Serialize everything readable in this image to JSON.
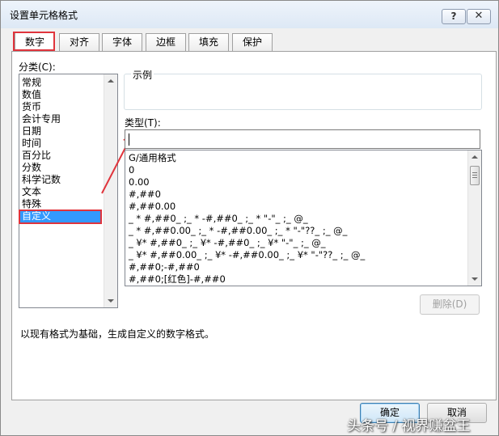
{
  "dialog": {
    "title": "设置单元格格式",
    "help_label": "?",
    "close_label": "✕"
  },
  "tabs": [
    "数字",
    "对齐",
    "字体",
    "边框",
    "填充",
    "保护"
  ],
  "category": {
    "label": "分类(C):",
    "items": [
      "常规",
      "数值",
      "货币",
      "会计专用",
      "日期",
      "时间",
      "百分比",
      "分数",
      "科学记数",
      "文本",
      "特殊",
      "自定义"
    ],
    "selected": "自定义"
  },
  "sample": {
    "label": "示例"
  },
  "type": {
    "label": "类型(T):",
    "value": "",
    "formats": [
      "G/通用格式",
      "0",
      "0.00",
      "#,##0",
      "#,##0.00",
      "_ * #,##0_ ;_ * -#,##0_ ;_ * \"-\"_ ;_ @_",
      "_ * #,##0.00_ ;_ * -#,##0.00_ ;_ * \"-\"??_ ;_ @_",
      "_ ¥* #,##0_ ;_ ¥* -#,##0_ ;_ ¥* \"-\"_ ;_ @_",
      "_ ¥* #,##0.00_ ;_ ¥* -#,##0.00_ ;_ ¥* \"-\"??_ ;_ @_",
      "#,##0;-#,##0",
      "#,##0;[红色]-#,##0"
    ]
  },
  "delete_label": "删除(D)",
  "description": "以现有格式为基础，生成自定义的数字格式。",
  "footer": {
    "ok_label": "确定",
    "cancel_label": "取消"
  },
  "watermark": "头条号 / 视界赚盆王",
  "colors": {
    "highlight_red": "#e0343c",
    "selection_blue": "#3399ff"
  }
}
